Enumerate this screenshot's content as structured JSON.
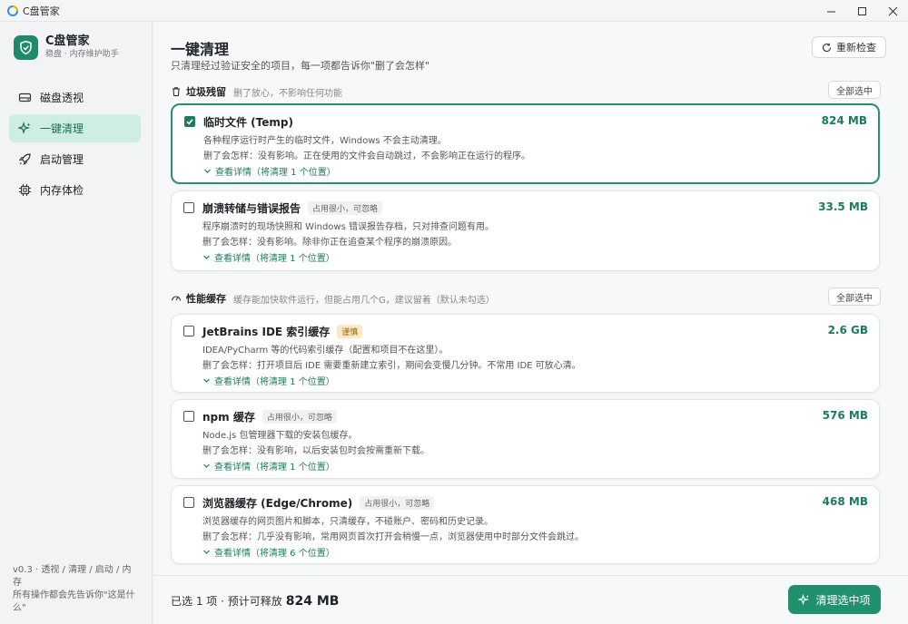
{
  "window": {
    "title": "C盘管家"
  },
  "brand": {
    "name": "C盘管家",
    "subtitle": "稳盘 · 内存维护助手"
  },
  "nav": [
    {
      "label": "磁盘透视",
      "icon": "disk-icon"
    },
    {
      "label": "一键清理",
      "icon": "sparkle-icon",
      "active": true
    },
    {
      "label": "启动管理",
      "icon": "rocket-icon"
    },
    {
      "label": "内存体检",
      "icon": "chip-icon"
    }
  ],
  "footer": {
    "line1": "v0.3 · 透视 / 清理 / 启动 / 内存",
    "line2": "所有操作都会先告诉你\"这是什么\""
  },
  "header": {
    "title": "一键清理",
    "subtitle": "只清理经过验证安全的项目，每一项都告诉你\"删了会怎样\"",
    "refresh_label": "重新检查"
  },
  "sections": {
    "junk": {
      "name": "垃圾残留",
      "desc": "删了放心，不影响任何功能",
      "select_all": "全部选中"
    },
    "perf": {
      "name": "性能缓存",
      "desc": "缓存能加快软件运行，但能占用几个G，建议留着（默认未勾选）",
      "select_all": "全部选中"
    }
  },
  "items": [
    {
      "name": "临时文件 (Temp)",
      "tag": "",
      "size": "824 MB",
      "checked": true,
      "desc": "各种程序运行时产生的临时文件，Windows 不会主动清理。",
      "impact": "删了会怎样：没有影响。正在使用的文件会自动跳过，不会影响正在运行的程序。",
      "details": "查看详情（将清理 1 个位置）"
    },
    {
      "name": "崩溃转储与错误报告",
      "tag": "占用很小，可忽略",
      "size": "33.5 MB",
      "checked": false,
      "desc": "程序崩溃时的现场快照和 Windows 错误报告存档，只对排查问题有用。",
      "impact": "删了会怎样：没有影响。除非你正在追查某个程序的崩溃原因。",
      "details": "查看详情（将清理 1 个位置）"
    },
    {
      "name": "JetBrains IDE 索引缓存",
      "tag": "谨慎",
      "tag_warn": true,
      "size": "2.6 GB",
      "checked": false,
      "desc": "IDEA/PyCharm 等的代码索引缓存（配置和项目不在这里）。",
      "impact": "删了会怎样：打开项目后 IDE 需要重新建立索引，期间会变慢几分钟。不常用 IDE 可放心清。",
      "details": "查看详情（将清理 1 个位置）"
    },
    {
      "name": "npm 缓存",
      "tag": "占用很小，可忽略",
      "size": "576 MB",
      "checked": false,
      "desc": "Node.js 包管理器下载的安装包缓存。",
      "impact": "删了会怎样：没有影响，以后安装包时会按需重新下载。",
      "details": "查看详情（将清理 1 个位置）"
    },
    {
      "name": "浏览器缓存 (Edge/Chrome)",
      "tag": "占用很小，可忽略",
      "size": "468 MB",
      "checked": false,
      "desc": "浏览器缓存的网页图片和脚本，只清缓存，不碰账户、密码和历史记录。",
      "impact": "删了会怎样：几乎没有影响，常用网页首次打开会稍慢一点，浏览器使用中时部分文件会跳过。",
      "details": "查看详情（将清理 6 个位置）"
    }
  ],
  "bottom": {
    "summary": "已选 1 项 · 预计可释放",
    "total": "824 MB",
    "clean_label": "清理选中项"
  },
  "colors": {
    "accent": "#21916d",
    "active_bg": "#cdeee0",
    "size_text": "#1e7a5c"
  }
}
